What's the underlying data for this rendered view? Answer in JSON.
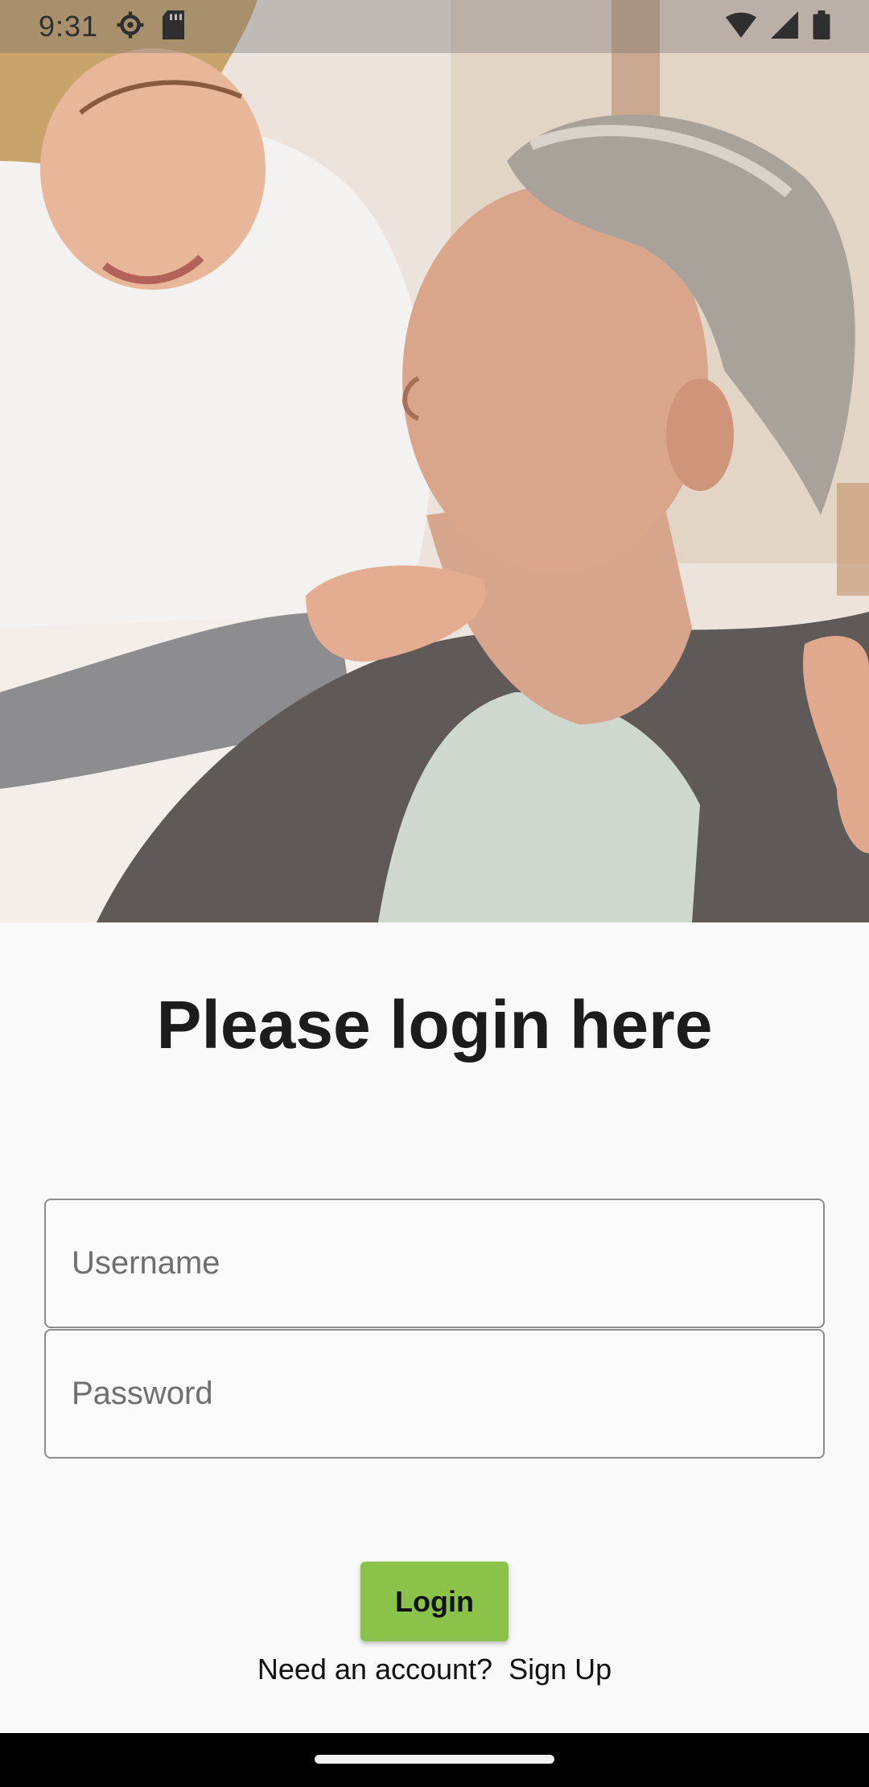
{
  "status_bar": {
    "time": "9:31",
    "icons": [
      "settings-icon",
      "sd-card-icon",
      "wifi-icon",
      "signal-icon",
      "battery-icon"
    ]
  },
  "hero": {
    "description_icon": "caregiver-photo"
  },
  "login": {
    "title": "Please login here",
    "username_placeholder": "Username",
    "password_placeholder": "Password",
    "login_label": "Login",
    "need_account_text": "Need an account?",
    "signup_label": "Sign Up"
  },
  "colors": {
    "accent": "#8bc34a",
    "background": "#f9f9f9"
  }
}
